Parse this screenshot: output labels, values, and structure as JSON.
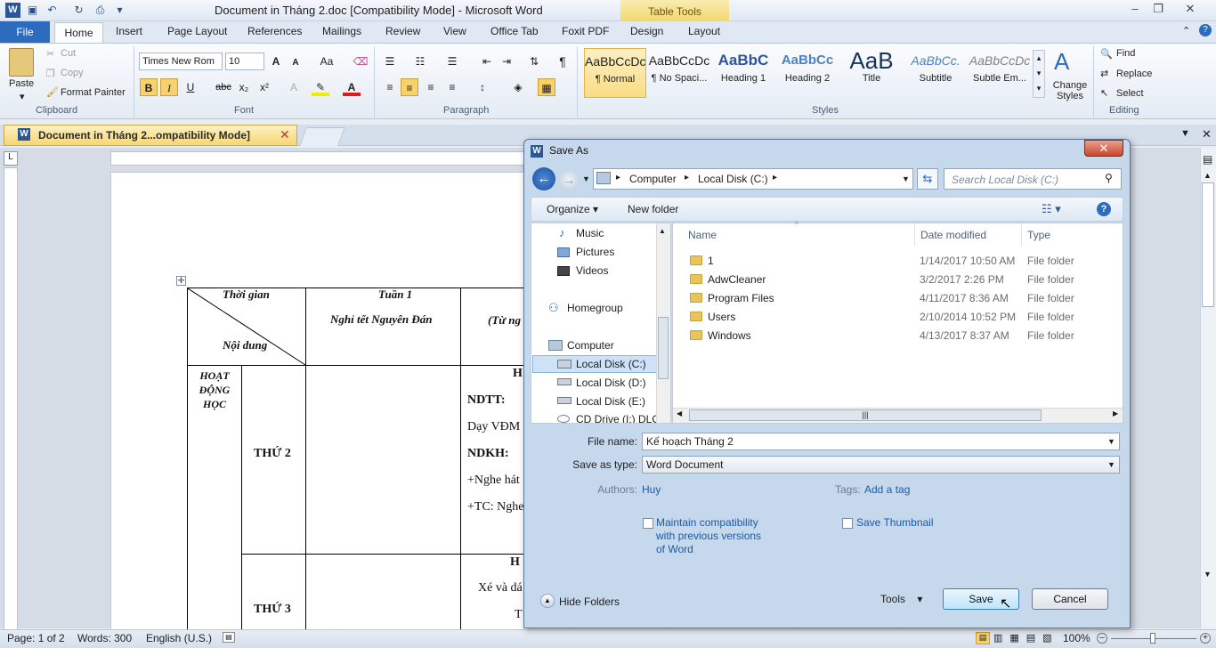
{
  "window": {
    "title": "Document in Tháng 2.doc [Compatibility Mode]  -  Microsoft Word",
    "contextual_tab_group": "Table Tools"
  },
  "ribbon_tabs": [
    "File",
    "Home",
    "Insert",
    "Page Layout",
    "References",
    "Mailings",
    "Review",
    "View",
    "Office Tab",
    "Foxit PDF",
    "Design",
    "Layout"
  ],
  "clipboard": {
    "paste": "Paste",
    "cut": "Cut",
    "copy": "Copy",
    "format_painter": "Format Painter",
    "label": "Clipboard"
  },
  "font": {
    "name": "Times New Rom",
    "size": "10",
    "label": "Font",
    "bold": "B",
    "italic": "I",
    "underline": "U",
    "strike": "abc",
    "sub": "x₂",
    "sup": "x²",
    "grow": "A",
    "shrink": "A",
    "case": "Aa"
  },
  "paragraph": {
    "label": "Paragraph"
  },
  "styles": {
    "label": "Styles",
    "items": [
      {
        "preview": "AaBbCcDc",
        "name": "¶ Normal"
      },
      {
        "preview": "AaBbCcDc",
        "name": "¶ No Spaci..."
      },
      {
        "preview": "AaBbC",
        "name": "Heading 1"
      },
      {
        "preview": "AaBbCc",
        "name": "Heading 2"
      },
      {
        "preview": "AaB",
        "name": "Title"
      },
      {
        "preview": "AaBbCc.",
        "name": "Subtitle"
      },
      {
        "preview": "AaBbCcDc",
        "name": "Subtle Em..."
      }
    ],
    "change": "Change Styles"
  },
  "editing": {
    "label": "Editing",
    "find": "Find",
    "replace": "Replace",
    "select": "Select"
  },
  "doc_tab": "Document in Tháng 2...ompatibility Mode]",
  "document": {
    "header_time": "Thời gian",
    "header_content": "Nội dung",
    "week1": "Tuần 1",
    "week1_note": "Nghỉ tết Nguyên Đán",
    "col3_partial": "(Từ ng",
    "section": "HOẠT ĐỘNG HỌC",
    "thu2": "THỨ 2",
    "thu3": "THỨ 3",
    "h_partial": "H",
    "ndtt": "NDTT:",
    "day_vdm": "Dạy  VĐM",
    "ndkh": "NDKH:",
    "nghe_hat": "+Nghe hát",
    "tc_nghe": "+TC: Nghe",
    "h2_partial": "H",
    "xe_va": "Xé và dá",
    "t_partial": "T"
  },
  "status": {
    "page": "Page: 1 of 2",
    "words": "Words: 300",
    "language": "English (U.S.)",
    "zoom": "100%"
  },
  "dialog": {
    "title": "Save As",
    "breadcrumb": [
      "Computer",
      "Local Disk (C:)"
    ],
    "search_placeholder": "Search Local Disk (C:)",
    "organize": "Organize",
    "new_folder": "New folder",
    "nav": [
      "Music",
      "Pictures",
      "Videos",
      "Homegroup",
      "Computer",
      "Local Disk (C:)",
      "Local Disk (D:)",
      "Local Disk (E:)",
      "CD Drive (I:) DLC"
    ],
    "columns": {
      "name": "Name",
      "date": "Date modified",
      "type": "Type"
    },
    "files": [
      {
        "name": "1",
        "date": "1/14/2017 10:50 AM",
        "type": "File folder"
      },
      {
        "name": "AdwCleaner",
        "date": "3/2/2017 2:26 PM",
        "type": "File folder"
      },
      {
        "name": "Program Files",
        "date": "4/11/2017 8:36 AM",
        "type": "File folder"
      },
      {
        "name": "Users",
        "date": "2/10/2014 10:52 PM",
        "type": "File folder"
      },
      {
        "name": "Windows",
        "date": "4/13/2017 8:37 AM",
        "type": "File folder"
      }
    ],
    "file_name_label": "File name:",
    "file_name": "Kế hoạch Tháng 2",
    "save_type_label": "Save as type:",
    "save_type": "Word Document",
    "authors_label": "Authors:",
    "authors": "Huy",
    "tags_label": "Tags:",
    "tags": "Add a tag",
    "maintain": "Maintain compatibility with previous versions of Word",
    "thumbnail": "Save Thumbnail",
    "hide_folders": "Hide Folders",
    "tools": "Tools",
    "save": "Save",
    "cancel": "Cancel"
  }
}
